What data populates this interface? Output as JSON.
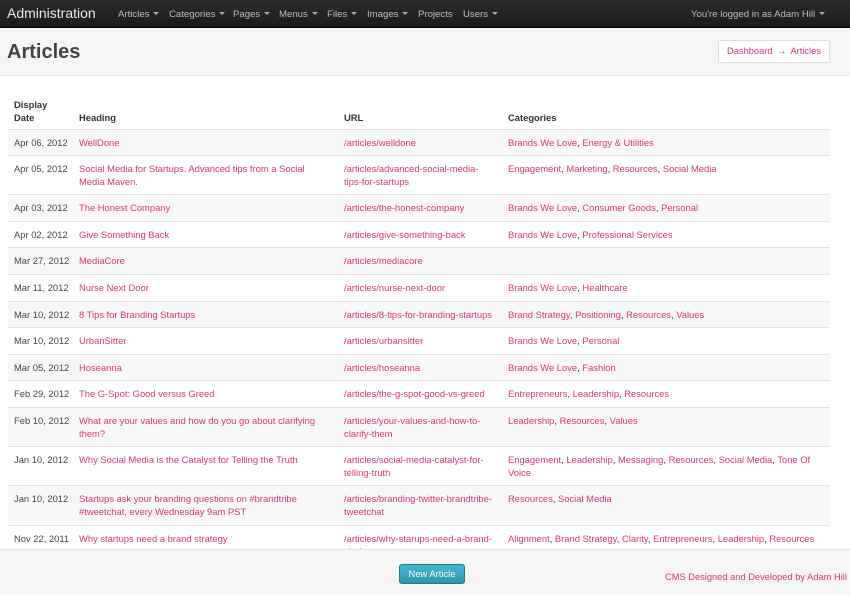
{
  "navbar": {
    "brand": "Administration",
    "items": [
      {
        "label": "Articles",
        "dropdown": true
      },
      {
        "label": "Categories",
        "dropdown": true
      },
      {
        "label": "Pages",
        "dropdown": true
      },
      {
        "label": "Menus",
        "dropdown": true
      },
      {
        "label": "Files",
        "dropdown": true
      },
      {
        "label": "Images",
        "dropdown": true
      },
      {
        "label": "Projects",
        "dropdown": false
      },
      {
        "label": "Users",
        "dropdown": true
      }
    ],
    "user_label": "You're logged in as Adam Hill"
  },
  "page": {
    "title": "Articles",
    "breadcrumb": {
      "home": "Dashboard",
      "separator": "→",
      "current": "Articles"
    }
  },
  "table": {
    "headers": {
      "date": "Display Date",
      "heading": "Heading",
      "url": "URL",
      "categories": "Categories"
    },
    "rows": [
      {
        "date": "Apr 06, 2012",
        "heading": "WellDone",
        "url": "/articles/welldone",
        "categories": [
          "Brands We Love",
          "Energy & Utilities"
        ]
      },
      {
        "date": "Apr 05, 2012",
        "heading": "Social Media for Startups. Advanced tips from a Social Media Maven.",
        "url": "/articles/advanced-social-media-tips-for-startups",
        "categories": [
          "Engagement",
          "Marketing",
          "Resources",
          "Social Media"
        ]
      },
      {
        "date": "Apr 03, 2012",
        "heading": "The Honest Company",
        "url": "/articles/the-honest-company",
        "categories": [
          "Brands We Love",
          "Consumer Goods",
          "Personal"
        ]
      },
      {
        "date": "Apr 02, 2012",
        "heading": "Give Something Back",
        "url": "/articles/give-something-back",
        "categories": [
          "Brands We Love",
          "Professional Services"
        ]
      },
      {
        "date": "Mar 27, 2012",
        "heading": "MediaCore",
        "url": "/articles/mediacore",
        "categories": []
      },
      {
        "date": "Mar 11, 2012",
        "heading": "Nurse Next Door",
        "url": "/articles/nurse-next-door",
        "categories": [
          "Brands We Love",
          "Healthcare"
        ]
      },
      {
        "date": "Mar 10, 2012",
        "heading": "8 Tips for Branding Startups",
        "url": "/articles/8-tips-for-branding-startups",
        "categories": [
          "Brand Strategy",
          "Positioning",
          "Resources",
          "Values"
        ]
      },
      {
        "date": "Mar 10, 2012",
        "heading": "UrbanSitter",
        "url": "/articles/urbansitter",
        "categories": [
          "Brands We Love",
          "Personal"
        ]
      },
      {
        "date": "Mar 05, 2012",
        "heading": "Hoseanna",
        "url": "/articles/hoseanna",
        "categories": [
          "Brands We Love",
          "Fashion"
        ]
      },
      {
        "date": "Feb 29, 2012",
        "heading": "The G-Spot: Good versus Greed",
        "url": "/articles/the-g-spot-good-vs-greed",
        "categories": [
          "Entrepreneurs",
          "Leadership",
          "Resources"
        ]
      },
      {
        "date": "Feb 10, 2012",
        "heading": "What are your values and how do you go about clarifying them?",
        "url": "/articles/your-values-and-how-to-clarify-them",
        "categories": [
          "Leadership",
          "Resources",
          "Values"
        ]
      },
      {
        "date": "Jan 10, 2012",
        "heading": "Why Social Media is the Catalyst for Telling the Truth",
        "url": "/articles/social-media-catalyst-for-telling-truth",
        "categories": [
          "Engagement",
          "Leadership",
          "Messaging",
          "Resources",
          "Social Media",
          "Tone Of Voice"
        ]
      },
      {
        "date": "Jan 10, 2012",
        "heading": "Startups ask your branding questions on #brandtribe #tweetchat, every Wednesday 9am PST",
        "url": "/articles/branding-twitter-brandtribe-tweetchat",
        "categories": [
          "Resources",
          "Social Media"
        ]
      },
      {
        "date": "Nov 22, 2011",
        "heading": "Why startups need a brand strategy",
        "url": "/articles/why-starups-need-a-brand-strategy",
        "categories": [
          "Alignment",
          "Brand Strategy",
          "Clarity",
          "Entrepreneurs",
          "Leadership",
          "Resources"
        ]
      }
    ]
  },
  "footer": {
    "new_button": "New Article",
    "credit": "CMS Designed and Developed by Adam Hill"
  },
  "colors": {
    "link": "#d9366f",
    "navbar": "#1b1b1b",
    "button": "#2f9bb0"
  }
}
